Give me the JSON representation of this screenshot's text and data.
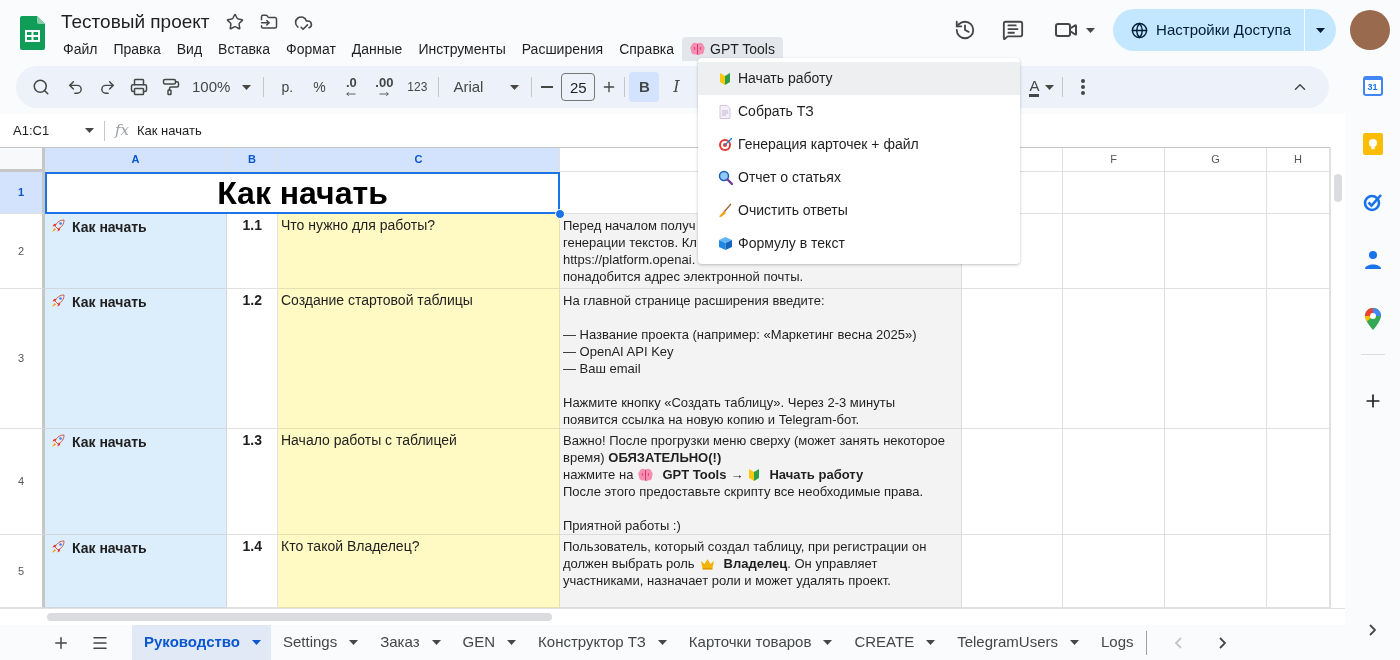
{
  "doc": {
    "title": "Тестовый проект"
  },
  "menu_bar": [
    {
      "label": "Файл",
      "kind": "plain",
      "open": false
    },
    {
      "label": "Правка",
      "kind": "plain",
      "open": false
    },
    {
      "label": "Вид",
      "kind": "plain",
      "open": false
    },
    {
      "label": "Вставка",
      "kind": "plain",
      "open": false
    },
    {
      "label": "Формат",
      "kind": "plain",
      "open": false
    },
    {
      "label": "Данные",
      "kind": "plain",
      "open": false
    },
    {
      "label": "Инструменты",
      "kind": "plain",
      "open": false
    },
    {
      "label": "Расширения",
      "kind": "plain",
      "open": false
    },
    {
      "label": "Справка",
      "kind": "plain",
      "open": false
    },
    {
      "label": "GPT Tools",
      "kind": "addon",
      "open": true
    }
  ],
  "share_button": {
    "label": "Настройки Доступа"
  },
  "toolbar": {
    "zoom": "100%",
    "currency": "р.",
    "percent": "%",
    "decrease_decimals": ".0",
    "increase_decimals": ".00",
    "number_format": "123",
    "font": "Arial",
    "font_size": "25",
    "bold_label": "B",
    "bold": true,
    "italic_label": "I",
    "italic": false,
    "text_color_label": "A"
  },
  "formula_bar": {
    "cell_range": "A1:C1",
    "fx_label": "fx",
    "formula": "Как начать"
  },
  "dropdown_menu": {
    "items": [
      {
        "label": "Начать работу",
        "selected": true
      },
      {
        "label": "Собрать ТЗ",
        "selected": false
      },
      {
        "label": "Генерация карточек + файл",
        "selected": false
      },
      {
        "label": "Отчет о статьях",
        "selected": false
      },
      {
        "label": "Очистить ответы",
        "selected": false
      },
      {
        "label": "Формулу в текст",
        "selected": false
      }
    ]
  },
  "grid": {
    "columns": [
      {
        "label": "A",
        "selected": true
      },
      {
        "label": "B",
        "selected": true
      },
      {
        "label": "C",
        "selected": true
      },
      {
        "selected": false
      },
      {
        "selected": false
      },
      {
        "label": "F",
        "selected": false
      },
      {
        "label": "G",
        "selected": false
      },
      {
        "label": "H",
        "selected": false
      }
    ],
    "rows": [
      {
        "number": "1",
        "selected": true,
        "title": "Как начать"
      },
      {
        "number": "2",
        "selected": false,
        "section": "Как начать",
        "index": "1.1",
        "question": "Что нужно для работы?",
        "answer": [
          [
            "Перед началом получ",
            "генерации текстов. Кл",
            "https://platform.openai.",
            "понадобится адрес электронной почты."
          ]
        ]
      },
      {
        "number": "3",
        "selected": false,
        "section": "Как начать",
        "index": "1.2",
        "question": "Создание стартовой таблицы",
        "answer": [
          [
            "На главной странице расширения введите:"
          ],
          [
            "— Название проекта (например: «Маркетинг весна 2025»)",
            "— OpenAI API Key",
            "— Ваш email"
          ],
          [
            "Нажмите кнопку «Создать таблицу». Через 2-3 минуты",
            "появится ссылка на новую копию и Telegram-бот."
          ]
        ]
      },
      {
        "number": "4",
        "selected": false,
        "section": "Как начать",
        "index": "1.3",
        "question": "Начало работы с таблицей",
        "answer": [
          [
            "Важно! После прогрузки меню сверху (может занять некоторое",
            "время) **ОБЯЗАТЕЛЬНО(!)**",
            [
              {
                "kind": "text",
                "text": "нажмите на",
                "bold": false
              },
              {
                "kind": "icon"
              },
              {
                "kind": "text",
                "text": "GPT Tools",
                "bold": true
              },
              {
                "kind": "text",
                "text": "→"
              },
              {
                "kind": "icon"
              },
              {
                "kind": "text",
                "text": "Начать работу",
                "bold": true
              }
            ],
            "После этого предоставьте скрипту все необходимые права."
          ],
          [
            "Приятной работы :)"
          ]
        ]
      },
      {
        "number": "5",
        "selected": false,
        "section": "Как начать",
        "index": "1.4",
        "question": "Кто такой Владелец?",
        "answer": [
          [
            "Пользователь, который создал таблицу, при регистрации он",
            [
              {
                "kind": "text",
                "text": "должен выбрать роль",
                "bold": false
              },
              {
                "kind": "icon"
              },
              {
                "kind": "text",
                "text": "Владелец",
                "bold": true
              },
              {
                "kind": "text",
                "text": ". Он управляет",
                "bold": false,
                "attached": true
              }
            ],
            "участниками, назначает роли и может удалять проект."
          ]
        ]
      }
    ]
  },
  "sheet_tabs": [
    {
      "label": "Руководство",
      "selected": true
    },
    {
      "label": "Settings",
      "selected": false
    },
    {
      "label": "Заказ",
      "selected": false
    },
    {
      "label": "GEN",
      "selected": false
    },
    {
      "label": "Конструктор ТЗ",
      "selected": false
    },
    {
      "label": "Карточки товаров",
      "selected": false
    },
    {
      "label": "CREATE",
      "selected": false
    },
    {
      "label": "TelegramUsers",
      "selected": false
    },
    {
      "label": "Logs",
      "selected": false
    }
  ],
  "side_panel": {
    "calendar_date": "31"
  }
}
